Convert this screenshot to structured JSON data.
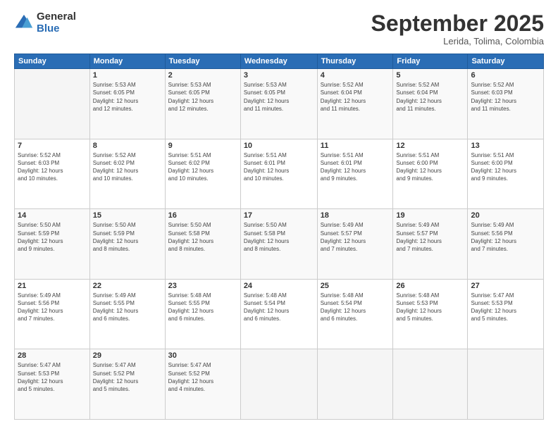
{
  "logo": {
    "general": "General",
    "blue": "Blue"
  },
  "header": {
    "month": "September 2025",
    "location": "Lerida, Tolima, Colombia"
  },
  "days_of_week": [
    "Sunday",
    "Monday",
    "Tuesday",
    "Wednesday",
    "Thursday",
    "Friday",
    "Saturday"
  ],
  "weeks": [
    [
      {
        "day": "",
        "info": ""
      },
      {
        "day": "1",
        "info": "Sunrise: 5:53 AM\nSunset: 6:05 PM\nDaylight: 12 hours\nand 12 minutes."
      },
      {
        "day": "2",
        "info": "Sunrise: 5:53 AM\nSunset: 6:05 PM\nDaylight: 12 hours\nand 12 minutes."
      },
      {
        "day": "3",
        "info": "Sunrise: 5:53 AM\nSunset: 6:05 PM\nDaylight: 12 hours\nand 11 minutes."
      },
      {
        "day": "4",
        "info": "Sunrise: 5:52 AM\nSunset: 6:04 PM\nDaylight: 12 hours\nand 11 minutes."
      },
      {
        "day": "5",
        "info": "Sunrise: 5:52 AM\nSunset: 6:04 PM\nDaylight: 12 hours\nand 11 minutes."
      },
      {
        "day": "6",
        "info": "Sunrise: 5:52 AM\nSunset: 6:03 PM\nDaylight: 12 hours\nand 11 minutes."
      }
    ],
    [
      {
        "day": "7",
        "info": "Sunrise: 5:52 AM\nSunset: 6:03 PM\nDaylight: 12 hours\nand 10 minutes."
      },
      {
        "day": "8",
        "info": "Sunrise: 5:52 AM\nSunset: 6:02 PM\nDaylight: 12 hours\nand 10 minutes."
      },
      {
        "day": "9",
        "info": "Sunrise: 5:51 AM\nSunset: 6:02 PM\nDaylight: 12 hours\nand 10 minutes."
      },
      {
        "day": "10",
        "info": "Sunrise: 5:51 AM\nSunset: 6:01 PM\nDaylight: 12 hours\nand 10 minutes."
      },
      {
        "day": "11",
        "info": "Sunrise: 5:51 AM\nSunset: 6:01 PM\nDaylight: 12 hours\nand 9 minutes."
      },
      {
        "day": "12",
        "info": "Sunrise: 5:51 AM\nSunset: 6:00 PM\nDaylight: 12 hours\nand 9 minutes."
      },
      {
        "day": "13",
        "info": "Sunrise: 5:51 AM\nSunset: 6:00 PM\nDaylight: 12 hours\nand 9 minutes."
      }
    ],
    [
      {
        "day": "14",
        "info": "Sunrise: 5:50 AM\nSunset: 5:59 PM\nDaylight: 12 hours\nand 9 minutes."
      },
      {
        "day": "15",
        "info": "Sunrise: 5:50 AM\nSunset: 5:59 PM\nDaylight: 12 hours\nand 8 minutes."
      },
      {
        "day": "16",
        "info": "Sunrise: 5:50 AM\nSunset: 5:58 PM\nDaylight: 12 hours\nand 8 minutes."
      },
      {
        "day": "17",
        "info": "Sunrise: 5:50 AM\nSunset: 5:58 PM\nDaylight: 12 hours\nand 8 minutes."
      },
      {
        "day": "18",
        "info": "Sunrise: 5:49 AM\nSunset: 5:57 PM\nDaylight: 12 hours\nand 7 minutes."
      },
      {
        "day": "19",
        "info": "Sunrise: 5:49 AM\nSunset: 5:57 PM\nDaylight: 12 hours\nand 7 minutes."
      },
      {
        "day": "20",
        "info": "Sunrise: 5:49 AM\nSunset: 5:56 PM\nDaylight: 12 hours\nand 7 minutes."
      }
    ],
    [
      {
        "day": "21",
        "info": "Sunrise: 5:49 AM\nSunset: 5:56 PM\nDaylight: 12 hours\nand 7 minutes."
      },
      {
        "day": "22",
        "info": "Sunrise: 5:49 AM\nSunset: 5:55 PM\nDaylight: 12 hours\nand 6 minutes."
      },
      {
        "day": "23",
        "info": "Sunrise: 5:48 AM\nSunset: 5:55 PM\nDaylight: 12 hours\nand 6 minutes."
      },
      {
        "day": "24",
        "info": "Sunrise: 5:48 AM\nSunset: 5:54 PM\nDaylight: 12 hours\nand 6 minutes."
      },
      {
        "day": "25",
        "info": "Sunrise: 5:48 AM\nSunset: 5:54 PM\nDaylight: 12 hours\nand 6 minutes."
      },
      {
        "day": "26",
        "info": "Sunrise: 5:48 AM\nSunset: 5:53 PM\nDaylight: 12 hours\nand 5 minutes."
      },
      {
        "day": "27",
        "info": "Sunrise: 5:47 AM\nSunset: 5:53 PM\nDaylight: 12 hours\nand 5 minutes."
      }
    ],
    [
      {
        "day": "28",
        "info": "Sunrise: 5:47 AM\nSunset: 5:53 PM\nDaylight: 12 hours\nand 5 minutes."
      },
      {
        "day": "29",
        "info": "Sunrise: 5:47 AM\nSunset: 5:52 PM\nDaylight: 12 hours\nand 5 minutes."
      },
      {
        "day": "30",
        "info": "Sunrise: 5:47 AM\nSunset: 5:52 PM\nDaylight: 12 hours\nand 4 minutes."
      },
      {
        "day": "",
        "info": ""
      },
      {
        "day": "",
        "info": ""
      },
      {
        "day": "",
        "info": ""
      },
      {
        "day": "",
        "info": ""
      }
    ]
  ]
}
